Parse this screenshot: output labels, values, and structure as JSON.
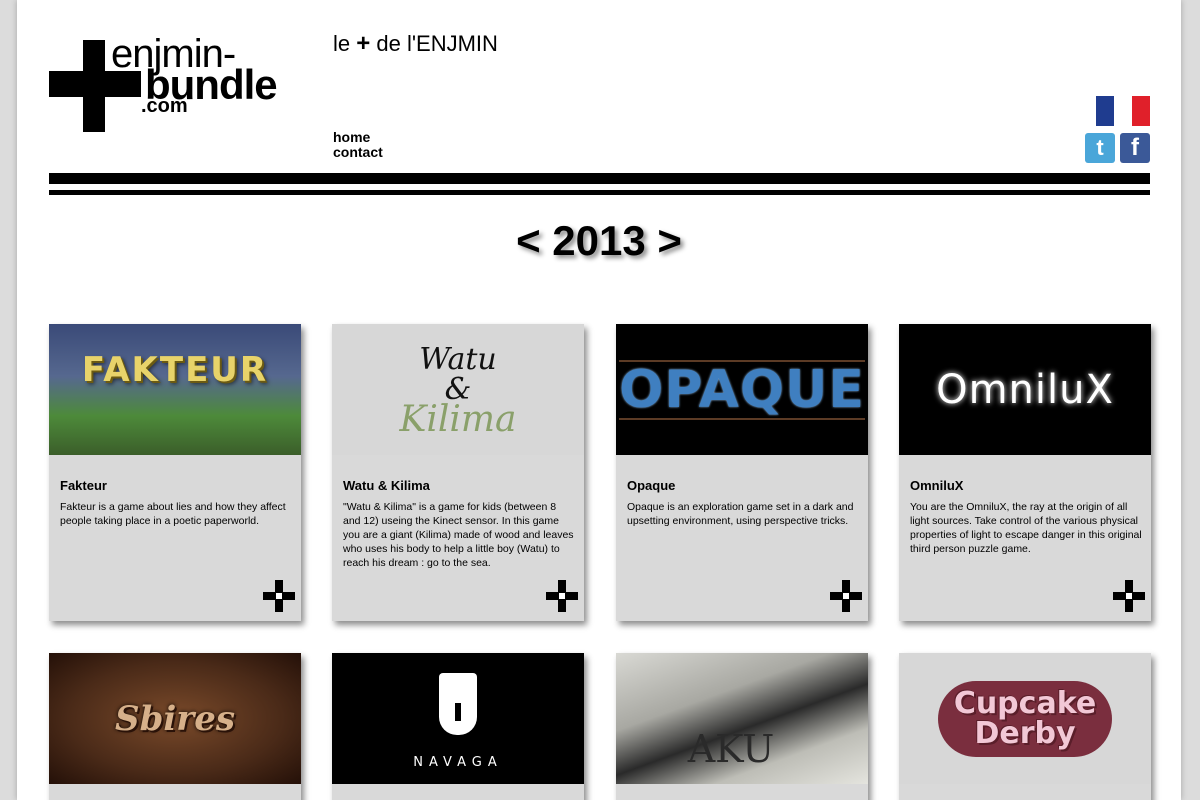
{
  "logo": {
    "line1": "enjmin-",
    "line2": "bundle",
    "line3": ".com"
  },
  "tagline": {
    "pre": "le ",
    "plus": "+",
    "post": " de l'ENJMIN"
  },
  "nav": {
    "home": "home",
    "contact": "contact"
  },
  "header_icons": {
    "flag_colors": [
      "#1f3c8f",
      "#ffffff",
      "#e0202a"
    ],
    "twitter": "t",
    "facebook": "f"
  },
  "year_nav": "< 2013 >",
  "games": [
    {
      "title": "Fakteur",
      "thumb_text": "FAKTEUR",
      "description": "Fakteur is a game about lies and how they affect people taking place in a poetic paperworld."
    },
    {
      "title": "Watu & Kilima",
      "thumb_text_1": "Watu",
      "thumb_text_2": "&",
      "thumb_text_3": "Kilima",
      "description": "\"Watu & Kilima\" is a game for kids (between 8 and 12) useing the Kinect sensor. In this game you are a giant (Kilima) made of wood and leaves who uses his body to help a little boy (Watu) to reach his dream : go to the sea."
    },
    {
      "title": "Opaque",
      "thumb_text": "OPAQUE",
      "description": "Opaque is an exploration game set in a dark and upsetting environment, using perspective tricks."
    },
    {
      "title": "OmniluX",
      "thumb_text": "OmniluX",
      "description": "You are the OmniluX, the ray at the origin of all light sources. Take control of the various physical properties of light to escape danger in this original third person puzzle game."
    },
    {
      "thumb_text": "Sbires"
    },
    {
      "thumb_text": "NAVAGA"
    },
    {
      "thumb_text": "AKU"
    },
    {
      "thumb_text_1": "Cupcake",
      "thumb_text_2": "Derby"
    }
  ]
}
